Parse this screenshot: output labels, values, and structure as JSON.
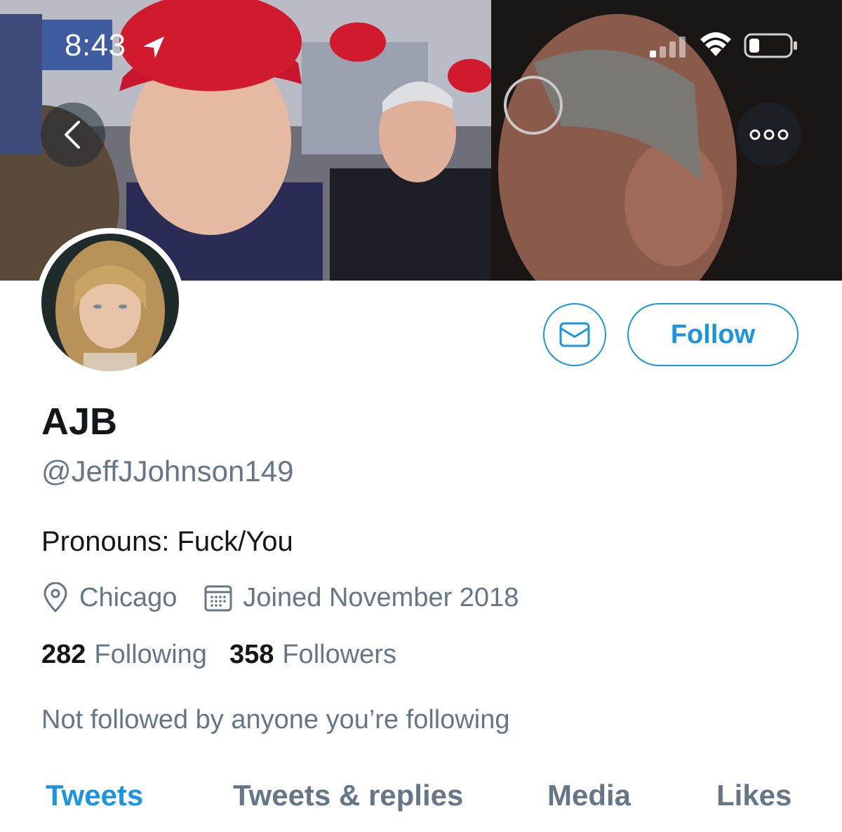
{
  "status_bar": {
    "time": "8:43"
  },
  "profile": {
    "display_name": "AJB",
    "handle": "@JeffJJohnson149",
    "bio": "Pronouns: Fuck/You",
    "location": "Chicago",
    "joined": "Joined November 2018",
    "following_count": "282",
    "following_label": "Following",
    "followers_count": "358",
    "followers_label": "Followers",
    "social_context": "Not followed by anyone you’re following"
  },
  "actions": {
    "follow_label": "Follow"
  },
  "tabs": [
    {
      "label": "Tweets",
      "active": true
    },
    {
      "label": "Tweets & replies",
      "active": false
    },
    {
      "label": "Media",
      "active": false
    },
    {
      "label": "Likes",
      "active": false
    }
  ],
  "colors": {
    "accent": "#1b95e0",
    "secondary_text": "#657786",
    "primary_text": "#14171a"
  },
  "icons": {
    "back": "chevron-left-icon",
    "more": "more-dots-icon",
    "message": "envelope-icon",
    "location": "location-pin-icon",
    "calendar": "calendar-icon"
  }
}
